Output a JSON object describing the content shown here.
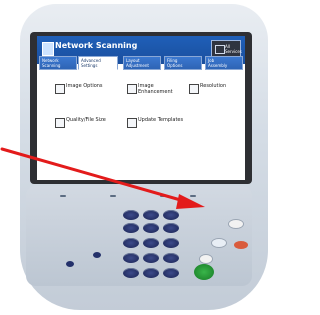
{
  "screen": {
    "title": "Network Scanning",
    "all_services_label": "All\nServices",
    "tabs": [
      {
        "label": "Network\nScanning",
        "active": false
      },
      {
        "label": "Advanced\nSettings",
        "active": true
      },
      {
        "label": "Layout\nAdjustment",
        "active": false
      },
      {
        "label": "Filing\nOptions",
        "active": false
      },
      {
        "label": "Job\nAssembly",
        "active": false
      }
    ],
    "options": [
      {
        "label": "Image Options"
      },
      {
        "label": "Image\nEnhancement"
      },
      {
        "label": "Resolution"
      },
      {
        "label": "Quality/File Size"
      },
      {
        "label": "Update Templates"
      }
    ]
  },
  "colors": {
    "header_blue": "#1f5fb8",
    "arrow_red": "#e31b1b"
  }
}
